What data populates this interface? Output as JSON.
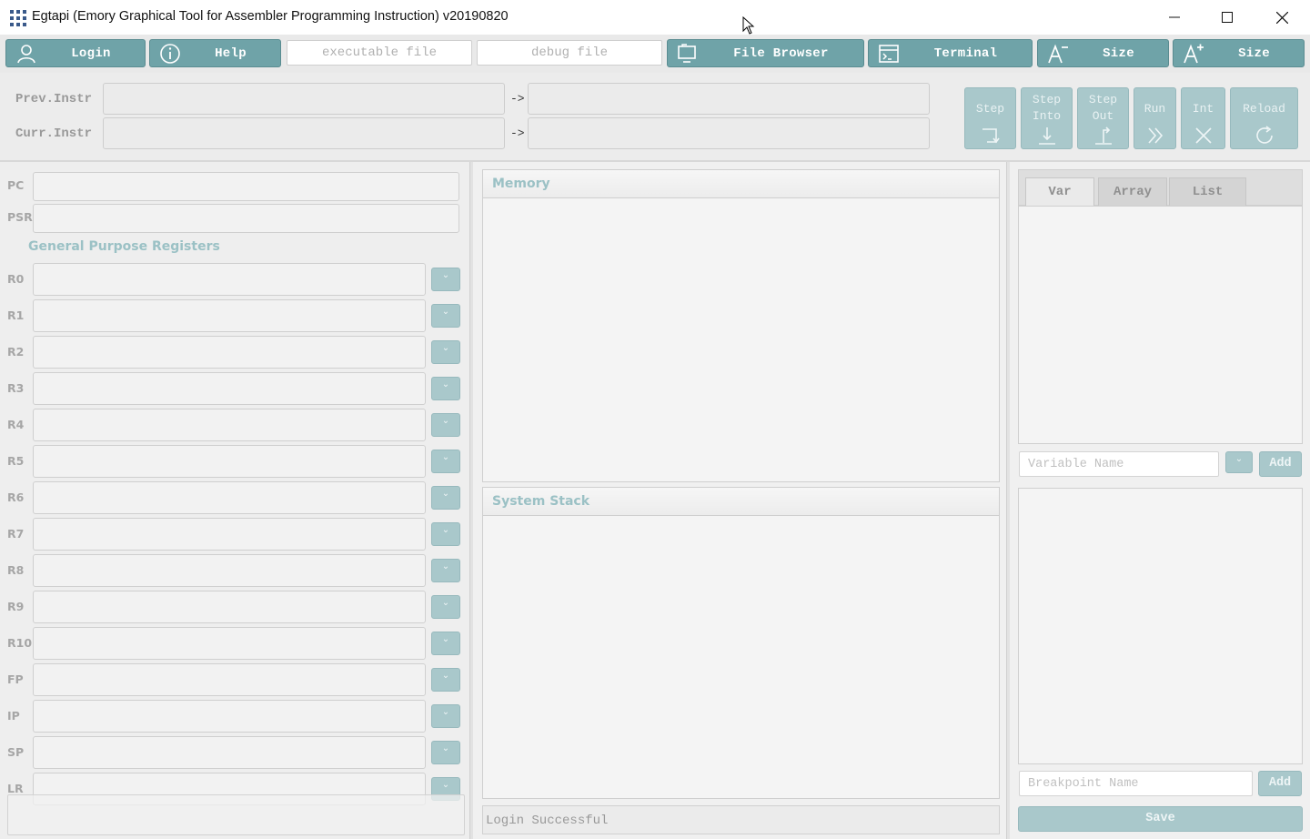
{
  "window": {
    "title": "Egtapi (Emory Graphical Tool for Assembler Programming Instruction) v20190820"
  },
  "toolbar": {
    "login_label": "Login",
    "help_label": "Help",
    "executable_placeholder": "executable file",
    "debug_placeholder": "debug file",
    "file_browser_label": "File Browser",
    "terminal_label": "Terminal",
    "size_decrease_label": "Size",
    "size_increase_label": "Size"
  },
  "instructions": {
    "prev_label": "Prev.Instr",
    "curr_label": "Curr.Instr",
    "arrow": "->"
  },
  "debug_buttons": {
    "step": "Step",
    "step_into_line1": "Step",
    "step_into_line2": "Into",
    "step_out_line1": "Step",
    "step_out_line2": "Out",
    "run": "Run",
    "int": "Int",
    "reload": "Reload"
  },
  "registers": {
    "pc_label": "PC",
    "psr_label": "PSR",
    "gpr_title": "General Purpose Registers",
    "labels": [
      "R0",
      "R1",
      "R2",
      "R3",
      "R4",
      "R5",
      "R6",
      "R7",
      "R8",
      "R9",
      "R10",
      "FP",
      "IP",
      "SP",
      "LR"
    ]
  },
  "memory": {
    "title": "Memory"
  },
  "stack": {
    "title": "System Stack"
  },
  "status": {
    "message": "Login Successful"
  },
  "watch": {
    "tabs": [
      "Var",
      "Array",
      "List"
    ],
    "active_tab": "Var",
    "variable_placeholder": "Variable Name",
    "add_label": "Add",
    "breakpoint_placeholder": "Breakpoint Name",
    "breakpoint_add_label": "Add",
    "save_label": "Save"
  },
  "colors": {
    "accent": "#6fa3a8",
    "accent_disabled": "#a9c8cb",
    "section_title": "#9bc1c5"
  }
}
